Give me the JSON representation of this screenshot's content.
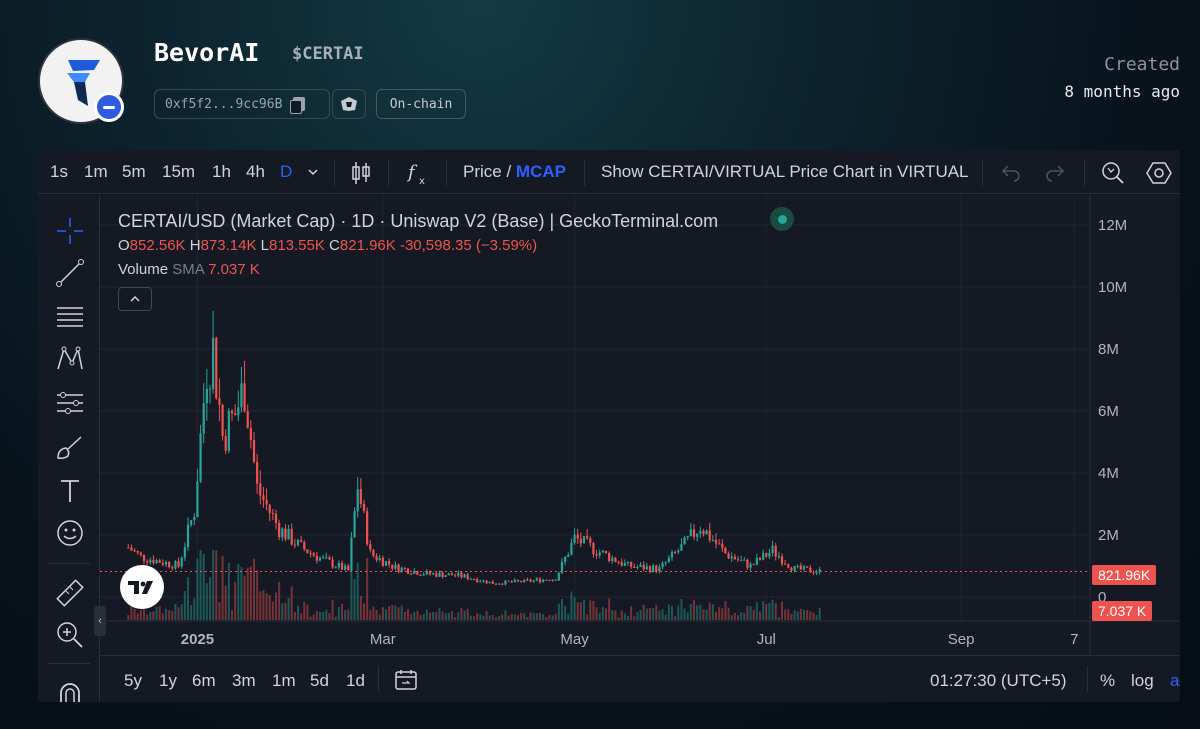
{
  "header": {
    "token_name": "BevorAI",
    "token_symbol": "$CERTAI",
    "address": "0xf5f2...9cc96B",
    "onchain_label": "On-chain",
    "created_label": "Created",
    "created_value": "8 months ago"
  },
  "toolbar": {
    "intervals": [
      "1s",
      "1m",
      "5m",
      "15m",
      "1h",
      "4h",
      "D"
    ],
    "active_interval": "D",
    "price_label": "Price",
    "price_sep": " / ",
    "mcap_label": "MCAP",
    "show_pair_label": "Show CERTAI/VIRTUAL Price Chart in VIRTUAL",
    "accent_color": "#2962ff"
  },
  "legend": {
    "title": "CERTAI/USD (Market Cap) · 1D · Uniswap V2 (Base) | GeckoTerminal.com",
    "o_label": "O",
    "o_value": "852.56K",
    "h_label": "H",
    "h_value": "873.14K",
    "l_label": "L",
    "l_value": "813.55K",
    "c_label": "C",
    "c_value": "821.96K",
    "change": "-30,598.35 (−3.59%)",
    "volume_label": "Volume",
    "sma_label": "SMA",
    "sma_value": "7.037 K"
  },
  "price_tags": {
    "last_price": "821.96K",
    "volume": "7.037 K"
  },
  "left_tools": [
    "crosshair-icon",
    "trendline-icon",
    "fib-lines-icon",
    "pattern-icon",
    "projection-icon",
    "brush-icon",
    "text-icon",
    "emoji-icon",
    "ruler-icon",
    "zoom-in-icon",
    "magnet-icon"
  ],
  "bottom": {
    "ranges": [
      "5y",
      "1y",
      "6m",
      "3m",
      "1m",
      "5d",
      "1d"
    ],
    "time": "01:27:30 (UTC+5)",
    "percent_label": "%",
    "log_label": "log",
    "auto_label": "auto"
  },
  "chart_data": {
    "type": "candlestick",
    "title": "CERTAI/USD (Market Cap) · 1D · Uniswap V2 (Base) | GeckoTerminal.com",
    "y_ticks": [
      "12M",
      "10M",
      "8M",
      "6M",
      "4M",
      "2M",
      "0"
    ],
    "x_ticks": [
      "2025",
      "Mar",
      "May",
      "Jul",
      "Sep",
      "7"
    ],
    "ylim": [
      0,
      12000000
    ],
    "grid": true,
    "up_color": "#26a69a",
    "down_color": "#ef5350",
    "series_close_path": [
      {
        "date": "2024-12-10",
        "close": 1600000
      },
      {
        "date": "2024-12-14",
        "close": 1300000
      },
      {
        "date": "2024-12-20",
        "close": 1150000
      },
      {
        "date": "2024-12-26",
        "close": 1000000
      },
      {
        "date": "2024-12-31",
        "close": 2800000
      },
      {
        "date": "2025-01-04",
        "close": 7500000
      },
      {
        "date": "2025-01-06",
        "close": 8000000
      },
      {
        "date": "2025-01-09",
        "close": 5200000
      },
      {
        "date": "2025-01-13",
        "close": 5900000
      },
      {
        "date": "2025-01-16",
        "close": 6800000
      },
      {
        "date": "2025-01-20",
        "close": 3500000
      },
      {
        "date": "2025-01-27",
        "close": 2200000
      },
      {
        "date": "2025-02-03",
        "close": 1600000
      },
      {
        "date": "2025-02-10",
        "close": 1200000
      },
      {
        "date": "2025-02-18",
        "close": 850000
      },
      {
        "date": "2025-02-21",
        "close": 3600000
      },
      {
        "date": "2025-02-25",
        "close": 1400000
      },
      {
        "date": "2025-03-05",
        "close": 950000
      },
      {
        "date": "2025-03-15",
        "close": 750000
      },
      {
        "date": "2025-03-25",
        "close": 700000
      },
      {
        "date": "2025-04-05",
        "close": 450000
      },
      {
        "date": "2025-04-15",
        "close": 500000
      },
      {
        "date": "2025-04-25",
        "close": 600000
      },
      {
        "date": "2025-05-01",
        "close": 1900000
      },
      {
        "date": "2025-05-08",
        "close": 1500000
      },
      {
        "date": "2025-05-18",
        "close": 1000000
      },
      {
        "date": "2025-05-28",
        "close": 900000
      },
      {
        "date": "2025-06-05",
        "close": 1700000
      },
      {
        "date": "2025-06-10",
        "close": 2300000
      },
      {
        "date": "2025-06-18",
        "close": 1400000
      },
      {
        "date": "2025-06-26",
        "close": 1000000
      },
      {
        "date": "2025-07-03",
        "close": 1500000
      },
      {
        "date": "2025-07-10",
        "close": 900000
      },
      {
        "date": "2025-07-18",
        "close": 821960
      }
    ],
    "last_close": 821960,
    "last_volume_sma": 7037
  }
}
